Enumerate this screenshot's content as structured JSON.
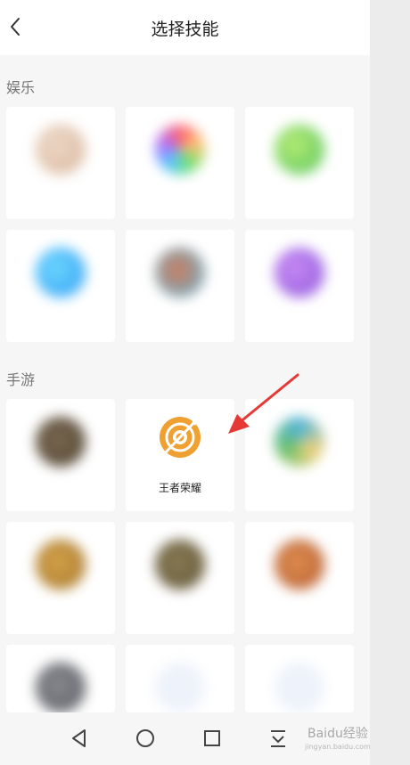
{
  "header": {
    "title": "选择技能"
  },
  "sections": [
    {
      "title": "娱乐"
    },
    {
      "title": "手游"
    }
  ],
  "featured_skill": {
    "name": "王者荣耀",
    "color": "#f0a030"
  },
  "watermark": {
    "text": "Baidu经验",
    "sub": "jingyan.baidu.com"
  },
  "icons": {
    "back": "chevron-left-icon",
    "arrow": "red-arrow",
    "nav": [
      "back-triangle-icon",
      "home-circle-icon",
      "recents-square-icon",
      "pull-down-icon"
    ]
  }
}
